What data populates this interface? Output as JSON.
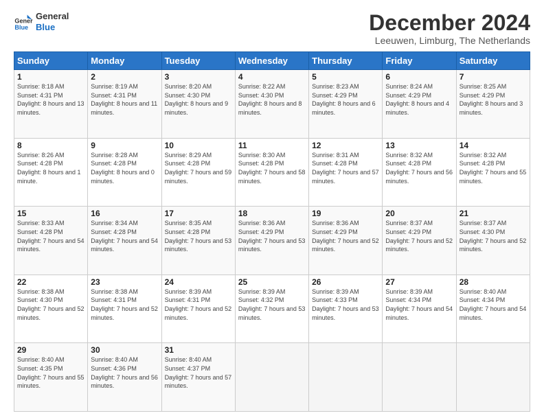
{
  "header": {
    "logo_line1": "General",
    "logo_line2": "Blue",
    "month": "December 2024",
    "location": "Leeuwen, Limburg, The Netherlands"
  },
  "weekdays": [
    "Sunday",
    "Monday",
    "Tuesday",
    "Wednesday",
    "Thursday",
    "Friday",
    "Saturday"
  ],
  "weeks": [
    [
      {
        "day": "1",
        "sunrise": "8:18 AM",
        "sunset": "4:31 PM",
        "daylight": "8 hours and 13 minutes."
      },
      {
        "day": "2",
        "sunrise": "8:19 AM",
        "sunset": "4:31 PM",
        "daylight": "8 hours and 11 minutes."
      },
      {
        "day": "3",
        "sunrise": "8:20 AM",
        "sunset": "4:30 PM",
        "daylight": "8 hours and 9 minutes."
      },
      {
        "day": "4",
        "sunrise": "8:22 AM",
        "sunset": "4:30 PM",
        "daylight": "8 hours and 8 minutes."
      },
      {
        "day": "5",
        "sunrise": "8:23 AM",
        "sunset": "4:29 PM",
        "daylight": "8 hours and 6 minutes."
      },
      {
        "day": "6",
        "sunrise": "8:24 AM",
        "sunset": "4:29 PM",
        "daylight": "8 hours and 4 minutes."
      },
      {
        "day": "7",
        "sunrise": "8:25 AM",
        "sunset": "4:29 PM",
        "daylight": "8 hours and 3 minutes."
      }
    ],
    [
      {
        "day": "8",
        "sunrise": "8:26 AM",
        "sunset": "4:28 PM",
        "daylight": "8 hours and 1 minute."
      },
      {
        "day": "9",
        "sunrise": "8:28 AM",
        "sunset": "4:28 PM",
        "daylight": "8 hours and 0 minutes."
      },
      {
        "day": "10",
        "sunrise": "8:29 AM",
        "sunset": "4:28 PM",
        "daylight": "7 hours and 59 minutes."
      },
      {
        "day": "11",
        "sunrise": "8:30 AM",
        "sunset": "4:28 PM",
        "daylight": "7 hours and 58 minutes."
      },
      {
        "day": "12",
        "sunrise": "8:31 AM",
        "sunset": "4:28 PM",
        "daylight": "7 hours and 57 minutes."
      },
      {
        "day": "13",
        "sunrise": "8:32 AM",
        "sunset": "4:28 PM",
        "daylight": "7 hours and 56 minutes."
      },
      {
        "day": "14",
        "sunrise": "8:32 AM",
        "sunset": "4:28 PM",
        "daylight": "7 hours and 55 minutes."
      }
    ],
    [
      {
        "day": "15",
        "sunrise": "8:33 AM",
        "sunset": "4:28 PM",
        "daylight": "7 hours and 54 minutes."
      },
      {
        "day": "16",
        "sunrise": "8:34 AM",
        "sunset": "4:28 PM",
        "daylight": "7 hours and 54 minutes."
      },
      {
        "day": "17",
        "sunrise": "8:35 AM",
        "sunset": "4:28 PM",
        "daylight": "7 hours and 53 minutes."
      },
      {
        "day": "18",
        "sunrise": "8:36 AM",
        "sunset": "4:29 PM",
        "daylight": "7 hours and 53 minutes."
      },
      {
        "day": "19",
        "sunrise": "8:36 AM",
        "sunset": "4:29 PM",
        "daylight": "7 hours and 52 minutes."
      },
      {
        "day": "20",
        "sunrise": "8:37 AM",
        "sunset": "4:29 PM",
        "daylight": "7 hours and 52 minutes."
      },
      {
        "day": "21",
        "sunrise": "8:37 AM",
        "sunset": "4:30 PM",
        "daylight": "7 hours and 52 minutes."
      }
    ],
    [
      {
        "day": "22",
        "sunrise": "8:38 AM",
        "sunset": "4:30 PM",
        "daylight": "7 hours and 52 minutes."
      },
      {
        "day": "23",
        "sunrise": "8:38 AM",
        "sunset": "4:31 PM",
        "daylight": "7 hours and 52 minutes."
      },
      {
        "day": "24",
        "sunrise": "8:39 AM",
        "sunset": "4:31 PM",
        "daylight": "7 hours and 52 minutes."
      },
      {
        "day": "25",
        "sunrise": "8:39 AM",
        "sunset": "4:32 PM",
        "daylight": "7 hours and 53 minutes."
      },
      {
        "day": "26",
        "sunrise": "8:39 AM",
        "sunset": "4:33 PM",
        "daylight": "7 hours and 53 minutes."
      },
      {
        "day": "27",
        "sunrise": "8:39 AM",
        "sunset": "4:34 PM",
        "daylight": "7 hours and 54 minutes."
      },
      {
        "day": "28",
        "sunrise": "8:40 AM",
        "sunset": "4:34 PM",
        "daylight": "7 hours and 54 minutes."
      }
    ],
    [
      {
        "day": "29",
        "sunrise": "8:40 AM",
        "sunset": "4:35 PM",
        "daylight": "7 hours and 55 minutes."
      },
      {
        "day": "30",
        "sunrise": "8:40 AM",
        "sunset": "4:36 PM",
        "daylight": "7 hours and 56 minutes."
      },
      {
        "day": "31",
        "sunrise": "8:40 AM",
        "sunset": "4:37 PM",
        "daylight": "7 hours and 57 minutes."
      },
      null,
      null,
      null,
      null
    ]
  ]
}
